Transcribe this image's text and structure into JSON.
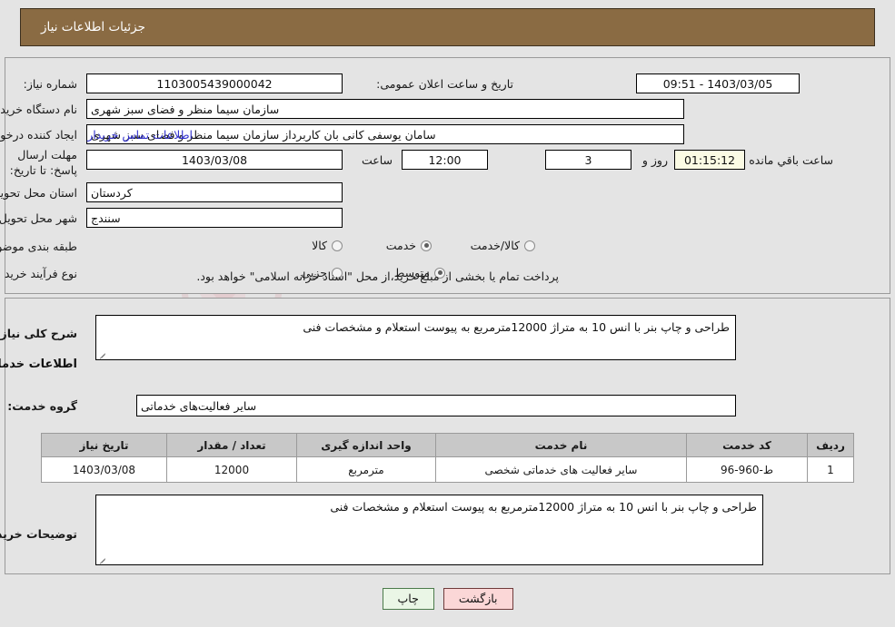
{
  "header": {
    "title": "جزئیات اطلاعات نیاز"
  },
  "top_form": {
    "need_number_label": "شماره نیاز:",
    "need_number_value": "1103005439000042",
    "announce_label": "تاریخ و ساعت اعلان عمومی:",
    "announce_value": "1403/03/05 - 09:51",
    "buyer_org_label": "نام دستگاه خریدار:",
    "buyer_org_value": "سازمان سیما  منظر و فضای سبز شهری",
    "creator_label": "ایجاد کننده درخواست:",
    "creator_value": "سامان یوسفی کانی بان کاربرداز سازمان سیما  منظر و فضای سبز شهری",
    "contact_link": "اطلاعات تماس خریدار",
    "deadline_label": "مهلت ارسال پاسخ: تا تاریخ:",
    "deadline_date": "1403/03/08",
    "hour_label": "ساعت",
    "hour_value": "12:00",
    "days_value": "3",
    "days_label": "روز و",
    "countdown_value": "01:15:12",
    "countdown_label": "ساعت باقي مانده",
    "province_label": "استان محل تحویل:",
    "province_value": "کردستان",
    "city_label": "شهر محل تحویل:",
    "city_value": "سنندج",
    "category_label": "طبقه بندی موضوعی:",
    "category_options": [
      {
        "label": "کالا",
        "selected": false
      },
      {
        "label": "خدمت",
        "selected": true
      },
      {
        "label": "کالا/خدمت",
        "selected": false
      }
    ],
    "process_label": "نوع فرآیند خرید :",
    "process_options": [
      {
        "label": "جزیی",
        "selected": false
      },
      {
        "label": "متوسط",
        "selected": true
      }
    ],
    "payment_note": "پرداخت تمام یا بخشی از مبلغ خرید،از محل \"اسناد خزانه اسلامی\" خواهد بود."
  },
  "mid": {
    "general_desc_label": "شرح کلی نیاز:",
    "general_desc_value": "طراحی و چاپ بنر با انس 10 به متراژ 12000مترمربع به پیوست استعلام و مشخصات فنی",
    "services_heading": "اطلاعات خدمات مورد نیاز",
    "service_group_label": "گروه خدمت:",
    "service_group_value": "سایر فعالیت‌های خدماتی",
    "buyer_notes_label": "توضیحات خریدار:",
    "buyer_notes_value": "طراحی و چاپ بنر با انس 10 به متراژ 12000مترمربع به پیوست استعلام و مشخصات فنی"
  },
  "table": {
    "columns": [
      "ردیف",
      "کد خدمت",
      "نام خدمت",
      "واحد اندازه گیری",
      "تعداد / مقدار",
      "تاریخ نیاز"
    ],
    "rows": [
      {
        "row": "1",
        "code": "ط-960-96",
        "name": "سایر فعالیت های خدماتی شخصی",
        "unit": "مترمربع",
        "qty": "12000",
        "date": "1403/03/08"
      }
    ]
  },
  "buttons": {
    "back": "بازگشت",
    "print": "چاپ"
  },
  "watermark": {
    "text_left": "Arta",
    "text_right": "Tender.net"
  },
  "colors": {
    "header_bg": "#8a6b43",
    "page_bg": "#e4e4e4",
    "link": "#3131cd",
    "table_header_bg": "#c8c8c8",
    "countdown_bg": "#fbfbe4",
    "btn_back_bg": "#fbd7d7",
    "btn_print_bg": "#eaf6e6"
  }
}
